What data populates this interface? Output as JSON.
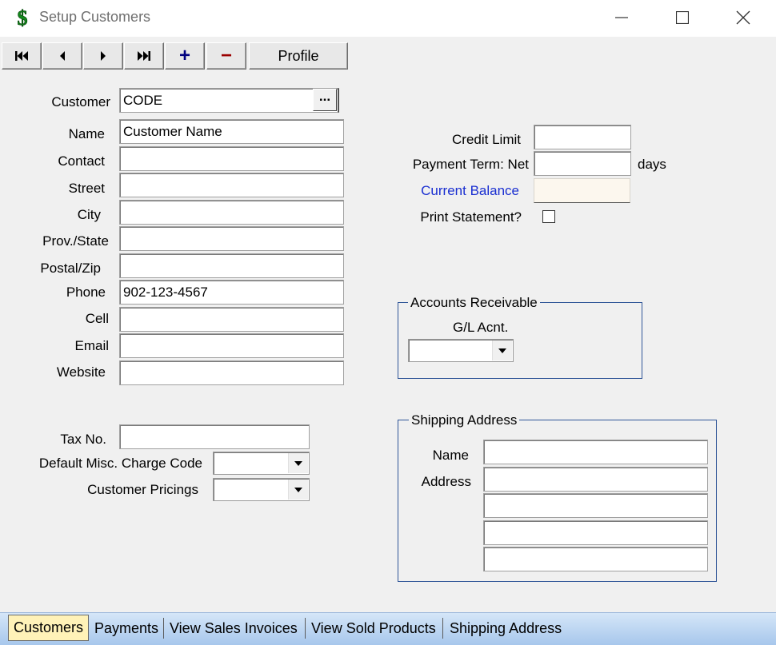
{
  "window": {
    "title": "Setup Customers",
    "icon": "dollar-sign-green-icon"
  },
  "toolbar": {
    "buttons": [
      {
        "name": "first-record",
        "icon": "skip-first-icon"
      },
      {
        "name": "previous-record",
        "icon": "triangle-left-icon"
      },
      {
        "name": "next-record",
        "icon": "triangle-right-icon"
      },
      {
        "name": "last-record",
        "icon": "skip-last-icon"
      },
      {
        "name": "add-record",
        "label": "+",
        "color": "#00007f"
      },
      {
        "name": "delete-record",
        "label": "−",
        "color": "#9b0000"
      }
    ],
    "profile_label": "Profile"
  },
  "customer": {
    "customer_label": "Customer",
    "customer_value": "CODE",
    "lookup_label": "...",
    "name_label": "Name",
    "name_value": "Customer Name",
    "contact_label": "Contact",
    "contact_value": "",
    "street_label": "Street",
    "street_value": "",
    "city_label": "City",
    "city_value": "",
    "prov_label": "Prov./State",
    "prov_value": "",
    "postal_label": "Postal/Zip",
    "postal_value": "",
    "phone_label": "Phone",
    "phone_value": "902-123-4567",
    "cell_label": "Cell",
    "cell_value": "",
    "email_label": "Email",
    "email_value": "",
    "website_label": "Website",
    "website_value": ""
  },
  "billing": {
    "credit_limit_label": "Credit Limit",
    "credit_limit_value": "",
    "payment_term_label": "Payment Term: Net",
    "payment_term_value": "",
    "days_label": "days",
    "current_balance_label": "Current Balance",
    "current_balance_value": "",
    "current_balance_color": "#1a2fd1",
    "print_statement_label": "Print Statement?",
    "print_statement_checked": false
  },
  "accounts_receivable": {
    "title": "Accounts Receivable",
    "gl_label": "G/L Acnt.",
    "gl_value": ""
  },
  "tax": {
    "tax_no_label": "Tax No.",
    "tax_no_value": "",
    "misc_charge_label": "Default Misc. Charge Code",
    "misc_charge_value": "",
    "pricings_label": "Customer Pricings",
    "pricings_value": ""
  },
  "shipping": {
    "title": "Shipping Address",
    "name_label": "Name",
    "name_value": "",
    "address_label": "Address",
    "address_lines": [
      "",
      "",
      "",
      ""
    ]
  },
  "tabs": [
    {
      "label": "Customers",
      "active": true
    },
    {
      "label": "Payments",
      "active": false
    },
    {
      "label": "View Sales Invoices",
      "active": false
    },
    {
      "label": "View Sold Products",
      "active": false
    },
    {
      "label": "Shipping Address",
      "active": false
    }
  ],
  "colors": {
    "group_border": "#2f5597",
    "tab_active": "#fff2b8",
    "tab_bar": "#a7c7ec"
  }
}
